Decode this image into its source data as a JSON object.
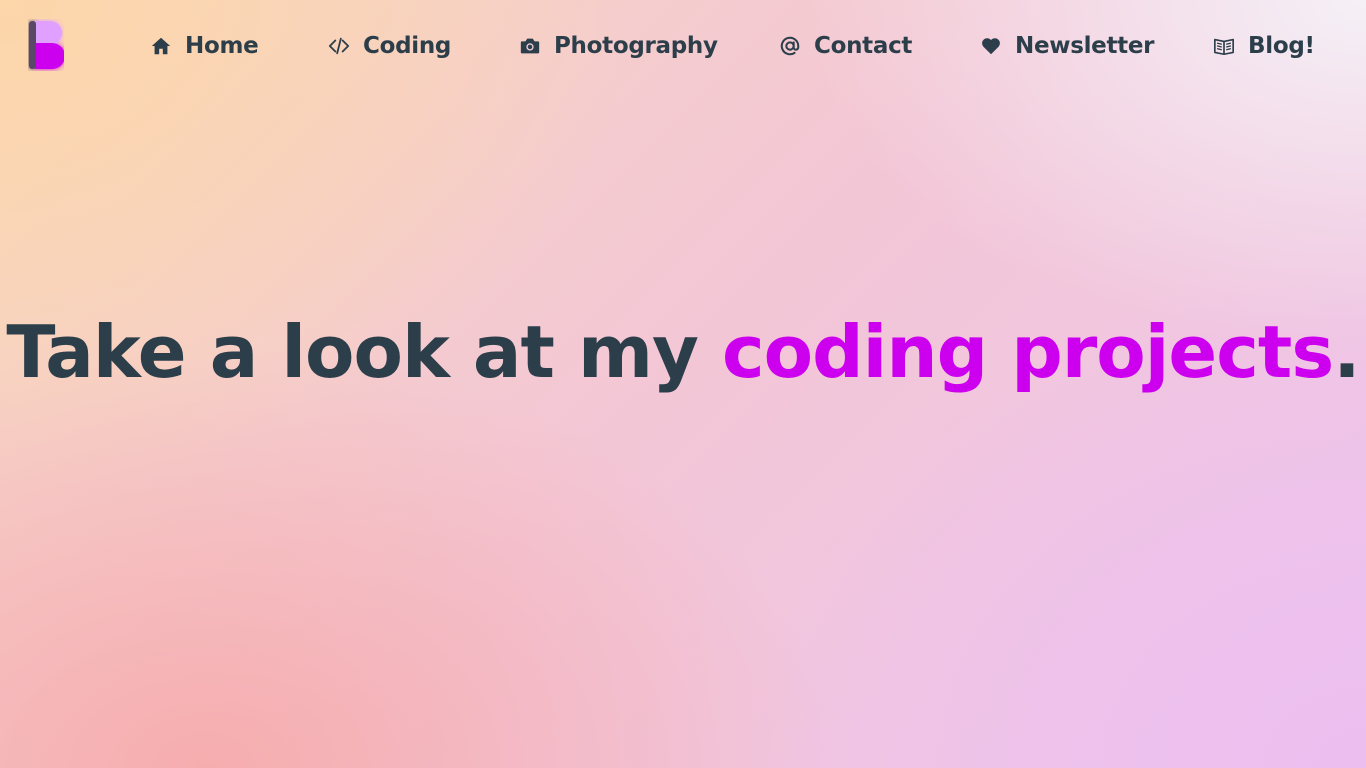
{
  "brand": {
    "logo_alt": "B logo"
  },
  "nav": {
    "items": [
      {
        "label": "Home",
        "icon": "home-icon"
      },
      {
        "label": "Coding",
        "icon": "code-icon"
      },
      {
        "label": "Photography",
        "icon": "camera-icon"
      },
      {
        "label": "Contact",
        "icon": "at-icon"
      },
      {
        "label": "Newsletter",
        "icon": "heart-icon"
      },
      {
        "label": "Blog!",
        "icon": "book-icon"
      }
    ]
  },
  "hero": {
    "lead": "Take a look at my ",
    "highlight": "coding projects",
    "trailing": "."
  },
  "colors": {
    "text": "#2c3e4a",
    "accent": "#cc00ee",
    "logo_light": "#e0a0ff",
    "logo_dark": "#5a4a66"
  }
}
